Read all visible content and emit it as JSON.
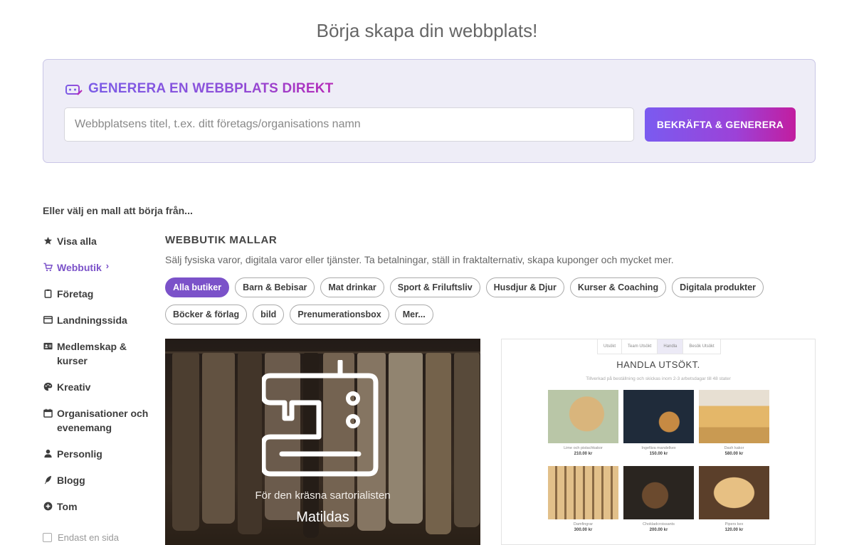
{
  "heading": "Börja skapa din webbplats!",
  "generator": {
    "title": "GENERERA EN WEBBPLATS DIREKT",
    "placeholder": "Webbplatsens titel, t.ex. ditt företags/organisations namn",
    "value": "",
    "button_label": "BEKRÄFTA & GENERERA",
    "icon": "robot-icon"
  },
  "choose_label": "Eller välj en mall att börja från...",
  "sidebar": {
    "items": [
      {
        "label": "Visa alla",
        "icon": "star-icon"
      },
      {
        "label": "Webbutik",
        "icon": "cart-icon",
        "active": true,
        "chevron": "›"
      },
      {
        "label": "Företag",
        "icon": "clipboard-icon"
      },
      {
        "label": "Landningssida",
        "icon": "window-icon"
      },
      {
        "label": "Medlemskap & kurser",
        "icon": "id-card-icon"
      },
      {
        "label": "Kreativ",
        "icon": "palette-icon"
      },
      {
        "label": "Organisationer och evenemang",
        "icon": "calendar-icon"
      },
      {
        "label": "Personlig",
        "icon": "user-icon"
      },
      {
        "label": "Blogg",
        "icon": "feather-icon"
      },
      {
        "label": "Tom",
        "icon": "plus-circle-icon"
      }
    ],
    "single_page_label": "Endast en sida"
  },
  "section": {
    "title": "WEBBUTIK MALLAR",
    "description": "Sälj fysiska varor, digitala varor eller tjänster. Ta betalningar, ställ in fraktalternativ, skapa kuponger och mycket mer."
  },
  "filters": {
    "row1": [
      "Alla butiker",
      "Barn & Bebisar",
      "Mat drinkar",
      "Sport & Friluftsliv",
      "Husdjur & Djur",
      "Kurser & Coaching",
      "Digitala produkter"
    ],
    "row2": [
      "Böcker & förlag",
      "bild",
      "Prenumerationsbox",
      "Mer..."
    ],
    "active": "Alla butiker"
  },
  "templates": {
    "left": {
      "tagline": "För den kräsna sartorialisten",
      "brand": "Matildas",
      "icon": "sewing-machine-icon"
    },
    "right": {
      "nav": [
        "Utsökt",
        "Team Utsökt",
        "Handla",
        "Besök Utsökt"
      ],
      "nav_selected": "Handla",
      "title": "HANDLA UTSÖKT.",
      "subtitle": "Tillverkad på beställning och skickas inom 2-3 arbetsdagar till 48 stater",
      "products": [
        {
          "name": "Lime och pistachkakor",
          "price": "210.00 kr"
        },
        {
          "name": "Ingefära mandelkex",
          "price": "150.00 kr"
        },
        {
          "name": "Dash kakor",
          "price": "580.00 kr"
        },
        {
          "name": "Damfingrar",
          "price": "300.00 kr"
        },
        {
          "name": "Chokladcroissants",
          "price": "200.00 kr"
        },
        {
          "name": "Pipers kex",
          "price": "120.00 kr"
        }
      ]
    }
  },
  "colors": {
    "accent": "#7b52c9",
    "gradient_start": "#7a5bf0",
    "gradient_end": "#c21d9f",
    "panel_bg": "#eeedf7"
  }
}
